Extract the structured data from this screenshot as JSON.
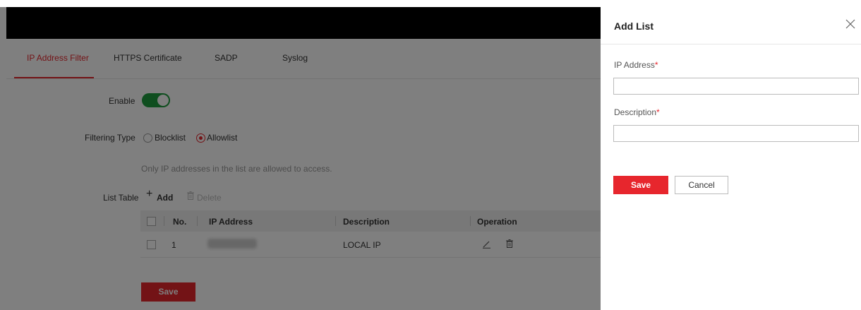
{
  "tabs": [
    {
      "label": "IP Address Filter",
      "active": true
    },
    {
      "label": "HTTPS Certificate",
      "active": false
    },
    {
      "label": "SADP",
      "active": false
    },
    {
      "label": "Syslog",
      "active": false
    }
  ],
  "form": {
    "enable_label": "Enable",
    "enable_on": true,
    "filtering_type_label": "Filtering Type",
    "filtering_options": [
      {
        "label": "Blocklist",
        "checked": false
      },
      {
        "label": "Allowlist",
        "checked": true
      }
    ],
    "hint": "Only IP addresses in the list are allowed to access.",
    "list_table_label": "List Table",
    "add_label": "Add",
    "delete_label": "Delete",
    "save_label": "Save"
  },
  "table": {
    "columns": [
      "No.",
      "IP Address",
      "Description",
      "Operation"
    ],
    "rows": [
      {
        "no": "1",
        "ip": "",
        "description": "LOCAL IP"
      }
    ]
  },
  "drawer": {
    "title": "Add List",
    "ip_label": "IP Address",
    "ip_value": "",
    "description_label": "Description",
    "description_value": "",
    "required_mark": "*",
    "save_label": "Save",
    "cancel_label": "Cancel"
  },
  "colors": {
    "accent": "#e7262d",
    "toggle_on": "#1f9d3f",
    "overlay": "rgba(0,0,0,0.5)"
  },
  "icons": [
    "plus-icon",
    "trash-icon",
    "edit-icon",
    "close-icon"
  ]
}
